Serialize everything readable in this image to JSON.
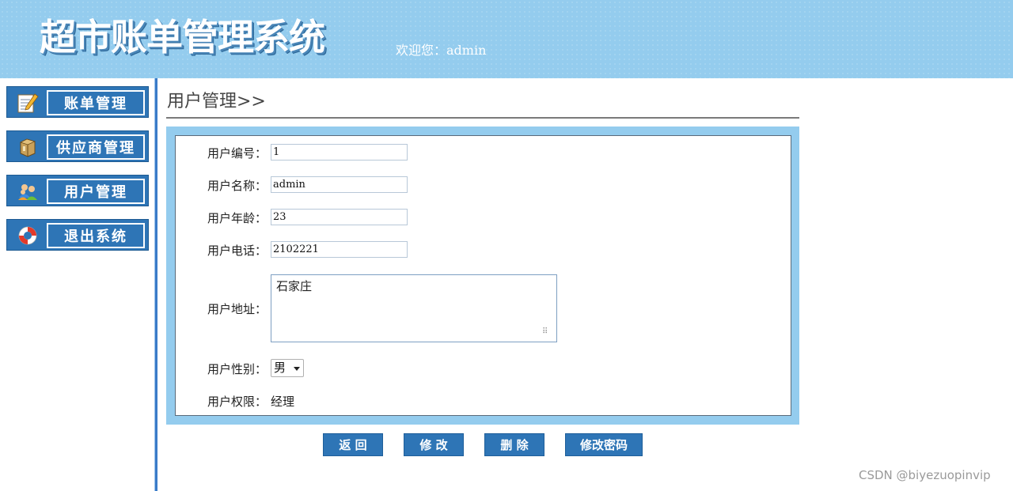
{
  "header": {
    "app_title": "超市账单管理系统",
    "welcome": "欢迎您：admin"
  },
  "sidebar": {
    "items": [
      {
        "label": "账单管理",
        "icon": "notepad-icon"
      },
      {
        "label": "供应商管理",
        "icon": "box-icon"
      },
      {
        "label": "用户管理",
        "icon": "users-icon"
      },
      {
        "label": "退出系统",
        "icon": "lifebuoy-icon"
      }
    ]
  },
  "main": {
    "page_title": "用户管理>>",
    "form": {
      "id_label": "用户编号：",
      "id_value": "1",
      "name_label": "用户名称：",
      "name_value": "admin",
      "age_label": "用户年龄：",
      "age_value": "23",
      "phone_label": "用户电话：",
      "phone_value": "2102221",
      "address_label": "用户地址：",
      "address_value": "石家庄",
      "gender_label": "用户性别：",
      "gender_value": "男",
      "role_label": "用户权限：",
      "role_value": "经理"
    },
    "buttons": {
      "back": "返 回",
      "edit": "修 改",
      "delete": "删 除",
      "change_password": "修改密码"
    }
  },
  "watermark": "CSDN @biyezuopinvip",
  "colors": {
    "header_bg": "#94ccee",
    "nav_bg": "#2e75b6",
    "frame_bg": "#94ccee"
  }
}
